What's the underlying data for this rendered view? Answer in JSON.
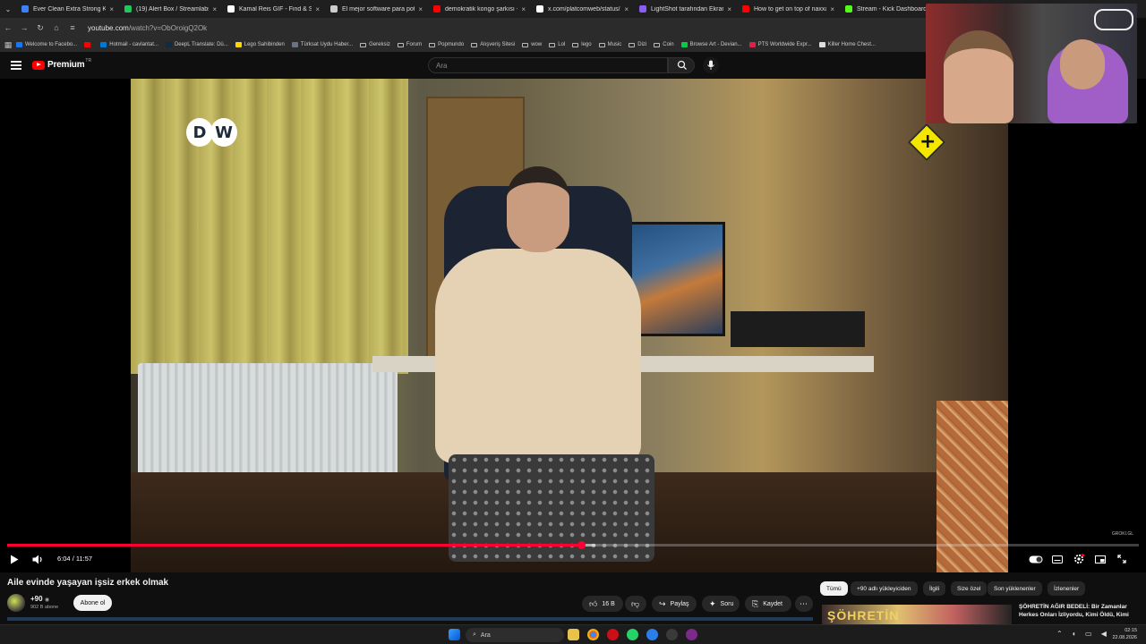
{
  "browser": {
    "tabs": [
      {
        "label": "Ever Clean Extra Strong Koku",
        "color": "#3b82f6"
      },
      {
        "label": "(19) Alert Box / Streamlabs",
        "color": "#22c55e"
      },
      {
        "label": "Kamal Reis GIF - Find & Share",
        "color": "#ffffff"
      },
      {
        "label": "El mejor software para poten",
        "color": "#cccccc"
      },
      {
        "label": "demokratik kongo şarkısı - ki",
        "color": "#ff0000"
      },
      {
        "label": "x.com/platcomweb/status/2",
        "color": "#ffffff"
      },
      {
        "label": "LightShot tarafından Ekran Gö",
        "color": "#8b5cf6"
      },
      {
        "label": "How to get on top of naxxar",
        "color": "#ff0000"
      },
      {
        "label": "Stream - Kick Dashboard",
        "color": "#53fc18"
      }
    ],
    "url_host": "youtube.com",
    "url_path": "/watch?v=ObOroigQ2Ok",
    "bookmarks": [
      {
        "label": "Welcome to Facebo...",
        "kind": "facebook-icon",
        "color": "#1877f2"
      },
      {
        "label": "",
        "kind": "youtube-icon",
        "color": "#ff0000"
      },
      {
        "label": "Hotmail - cavlantat...",
        "kind": "mail-icon",
        "color": "#0078d4"
      },
      {
        "label": "DeepL Translate: Dü...",
        "kind": "deepl-icon",
        "color": "#0f2b46"
      },
      {
        "label": "Lego Sahibinden",
        "kind": "lego-icon",
        "color": "#ffd500"
      },
      {
        "label": "Türksat Uydu Haber...",
        "kind": "satellite-icon",
        "color": "#6b7280"
      },
      {
        "label": "Gereksiz",
        "kind": "folder-icon"
      },
      {
        "label": "Forum",
        "kind": "folder-icon"
      },
      {
        "label": "Popmundo",
        "kind": "folder-icon"
      },
      {
        "label": "Alışveriş Sitesi",
        "kind": "folder-icon"
      },
      {
        "label": "wow",
        "kind": "folder-icon"
      },
      {
        "label": "Lol",
        "kind": "folder-icon"
      },
      {
        "label": "lego",
        "kind": "folder-icon"
      },
      {
        "label": "Music",
        "kind": "folder-icon"
      },
      {
        "label": "Dizi",
        "kind": "folder-icon"
      },
      {
        "label": "Coin",
        "kind": "folder-icon"
      },
      {
        "label": "Browse Art - Devian...",
        "kind": "deviantart-icon",
        "color": "#05cc47"
      },
      {
        "label": "PTS Worldwide Expr...",
        "kind": "pts-icon",
        "color": "#e11d48"
      },
      {
        "label": "Killer Home Chest...",
        "kind": "globe-icon",
        "color": "#dddddd"
      }
    ]
  },
  "youtube": {
    "brand": "Premium",
    "country": "TR",
    "search_placeholder": "Ara",
    "accent": "#ff0033"
  },
  "video": {
    "title": "Aile evinde yaşayan işsiz erkek olmak",
    "overlay_logo": [
      "D",
      "W"
    ],
    "current_time": "6:04",
    "duration": "11:57",
    "time_separator": " / ",
    "progress": 0.507,
    "buffered": 0.52,
    "watermark": "GROKI.GL"
  },
  "channel": {
    "name": "+90",
    "verified_icon": "verified-icon",
    "subscribers": "902 B abone",
    "subscribe_label": "Abone ol"
  },
  "actions": {
    "likes": "16 B",
    "share": "Paylaş",
    "ask": "Soru",
    "save": "Kaydet"
  },
  "chips": [
    "Tümü",
    "+90 adlı yükleyiciden",
    "İlgili",
    "Size özel",
    "Son yüklenenler",
    "İzlenenler"
  ],
  "recommendation": {
    "thumb_text": "ŞÖHRETİN",
    "title": "ŞÖHRETİN AĞIR BEDELİ: Bir Zamanlar Herkes Onları İzliyordu, Kimi Öldü, Kimi"
  },
  "taskbar": {
    "search_label": "Ara",
    "time": "02:15",
    "date": "22.08.2026"
  }
}
